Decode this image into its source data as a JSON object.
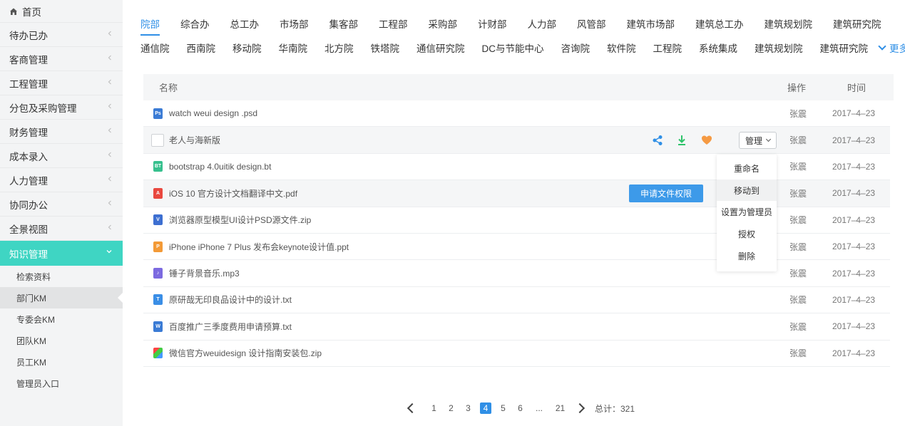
{
  "sidebar": {
    "home": "首页",
    "items": [
      {
        "label": "待办已办"
      },
      {
        "label": "客商管理"
      },
      {
        "label": "工程管理"
      },
      {
        "label": "分包及采购管理"
      },
      {
        "label": "财务管理"
      },
      {
        "label": "成本录入"
      },
      {
        "label": "人力管理"
      },
      {
        "label": "协同办公"
      },
      {
        "label": "全景视图"
      }
    ],
    "active": {
      "label": "知识管理"
    },
    "sub_items": [
      {
        "label": "检索资料"
      },
      {
        "label": "部门KM"
      },
      {
        "label": "专委会KM"
      },
      {
        "label": "团队KM"
      },
      {
        "label": "员工KM"
      },
      {
        "label": "管理员入口"
      }
    ]
  },
  "tabs_row1": [
    "院部",
    "综合办",
    "总工办",
    "市场部",
    "集客部",
    "工程部",
    "采购部",
    "计财部",
    "人力部",
    "风管部",
    "建筑市场部",
    "建筑总工办",
    "建筑规划院",
    "建筑研究院"
  ],
  "tabs_row2": [
    "通信院",
    "西南院",
    "移动院",
    "华南院",
    "北方院",
    "铁塔院",
    "通信研究院",
    "DC与节能中心",
    "咨询院",
    "软件院",
    "工程院",
    "系统集成",
    "建筑规划院",
    "建筑研究院"
  ],
  "more_label": "更多",
  "table": {
    "col_name": "名称",
    "col_op": "操作",
    "col_time": "时间",
    "rows": [
      {
        "name": "watch weui design .psd",
        "owner": "张震",
        "time": "2017–4–23",
        "icon": "Ps",
        "color": "#3a7bd5"
      },
      {
        "name": "老人与海新版",
        "owner": "张震",
        "time": "2017–4–23",
        "icon": "",
        "color": ""
      },
      {
        "name": "bootstrap 4.0uitik design.bt",
        "owner": "张震",
        "time": "2017–4–23",
        "icon": "BT",
        "color": "#37c08e"
      },
      {
        "name": "iOS 10 官方设计文档翻译中文.pdf",
        "owner": "张震",
        "time": "2017–4–23",
        "icon": "A",
        "color": "#e9483f"
      },
      {
        "name": "浏览器原型模型UI设计PSD源文件.zip",
        "owner": "张震",
        "time": "2017–4–23",
        "icon": "V",
        "color": "#3d6fd1"
      },
      {
        "name": "iPhone iPhone 7 Plus 发布会keynote设计值.ppt",
        "owner": "张震",
        "time": "2017–4–23",
        "icon": "P",
        "color": "#f39a37"
      },
      {
        "name": "锤子背景音乐.mp3",
        "owner": "张震",
        "time": "2017–4–23",
        "icon": "♪",
        "color": "#7c6ae0"
      },
      {
        "name": "原研哉无印良品设计中的设计.txt",
        "owner": "张震",
        "time": "2017–4–23",
        "icon": "T",
        "color": "#3a8ee6"
      },
      {
        "name": "百度推广三季度费用申请预算.txt",
        "owner": "张震",
        "time": "2017–4–23",
        "icon": "W",
        "color": "#3a7bd5"
      },
      {
        "name": "微信官方weuidesign 设计指南安装包.zip",
        "owner": "张震",
        "time": "2017–4–23",
        "icon": "",
        "color": "#ff9a3c"
      }
    ],
    "manage_label": "管理",
    "apply_label": "申请文件权限"
  },
  "menu": [
    "重命名",
    "移动到",
    "设置为管理员",
    "授权",
    "删除"
  ],
  "pager": {
    "pages": [
      "1",
      "2",
      "3",
      "4",
      "5",
      "6",
      "...",
      "21"
    ],
    "current": "4",
    "total": "总计：321"
  },
  "colors": {
    "accent": "#2f8fe6",
    "teal": "#3fd5c3",
    "share": "#2f8fe6",
    "download": "#2ec36a",
    "heart": "#f59a43"
  }
}
